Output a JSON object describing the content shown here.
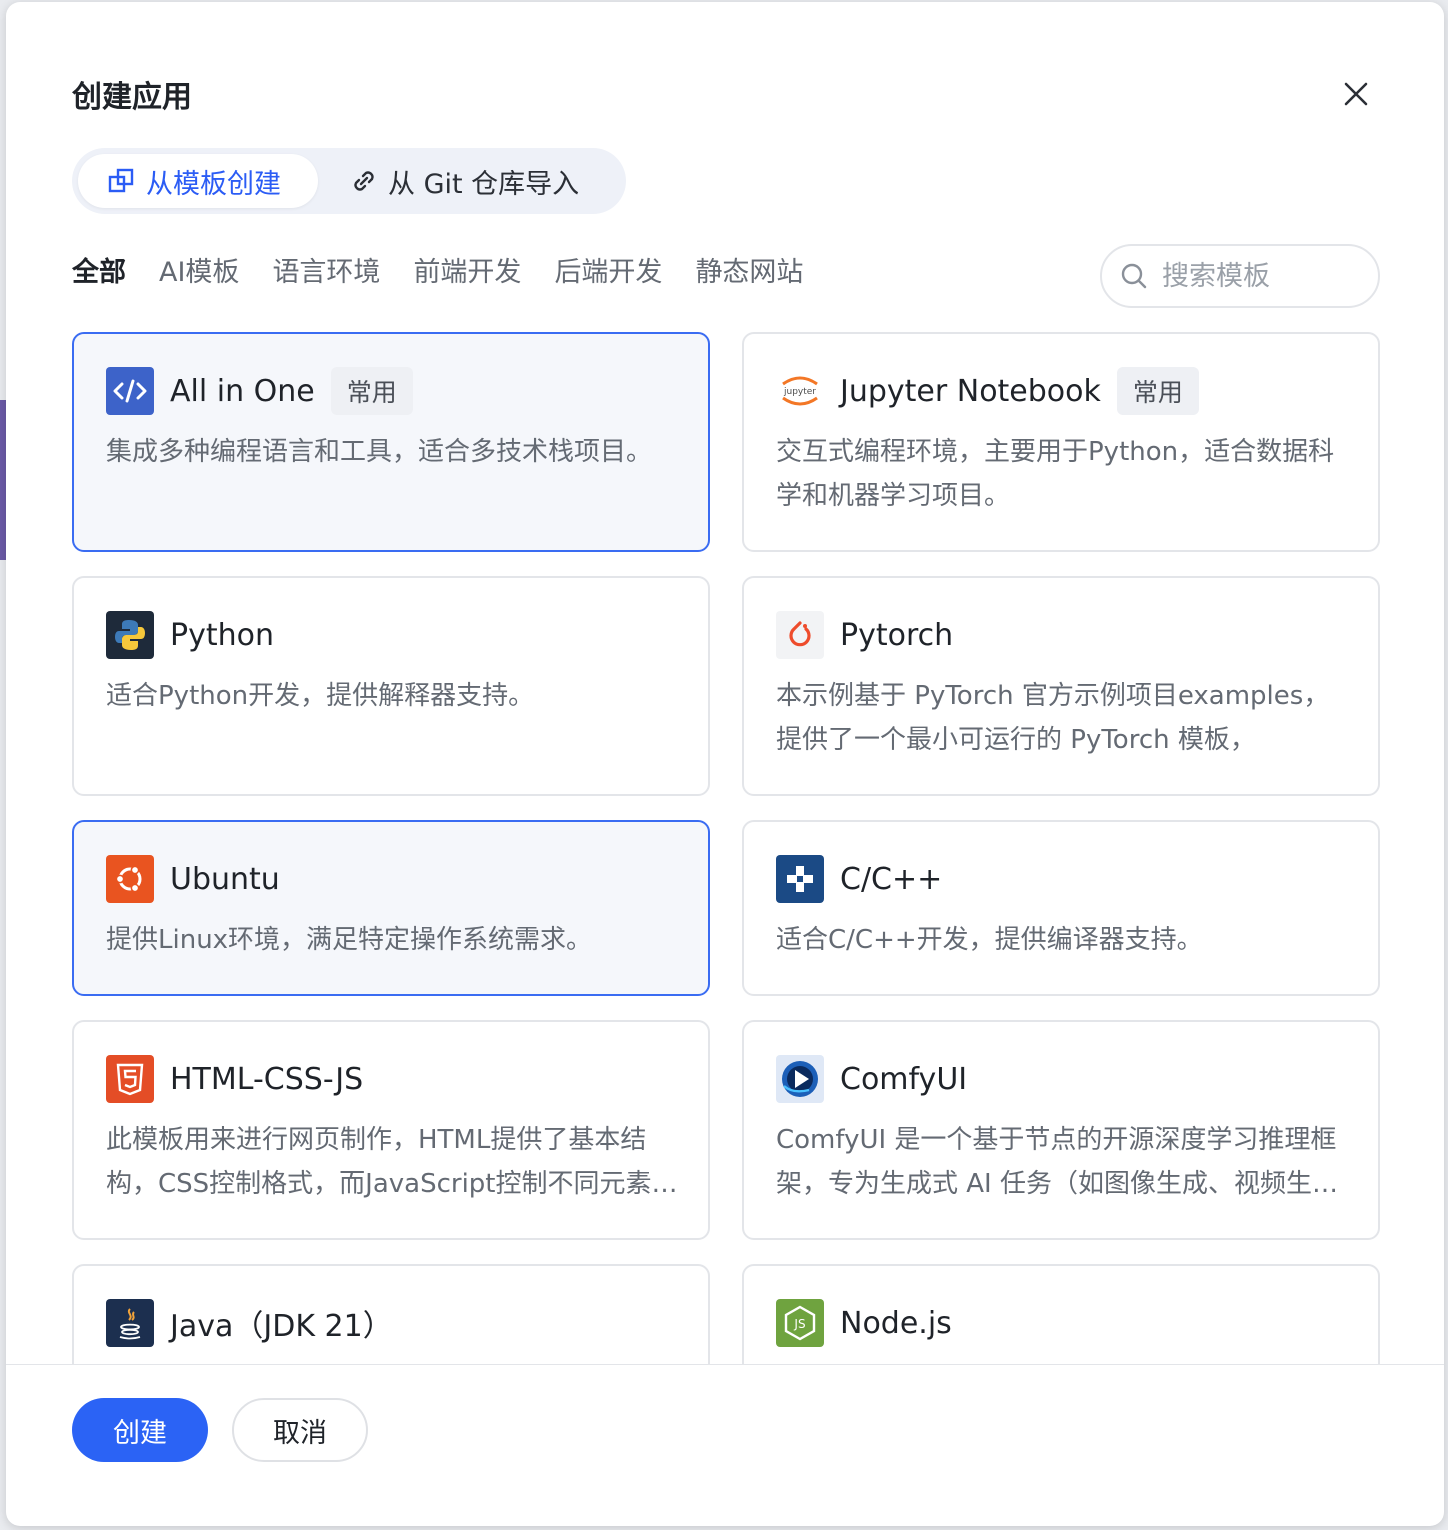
{
  "dialog": {
    "title": "创建应用",
    "close_icon": "close-icon"
  },
  "mode_tabs": [
    {
      "label": "从模板创建",
      "icon": "template-icon",
      "active": true
    },
    {
      "label": "从 Git 仓库导入",
      "icon": "link-icon",
      "active": false
    }
  ],
  "category_tabs": [
    {
      "label": "全部",
      "active": true
    },
    {
      "label": "AI模板",
      "active": false
    },
    {
      "label": "语言环境",
      "active": false
    },
    {
      "label": "前端开发",
      "active": false
    },
    {
      "label": "后端开发",
      "active": false
    },
    {
      "label": "静态网站",
      "active": false
    }
  ],
  "search": {
    "placeholder": "搜索模板",
    "value": ""
  },
  "templates": [
    {
      "name": "All in One",
      "badge": "常用",
      "desc": "集成多种编程语言和工具，适合多技术栈项目。",
      "icon": "code-icon",
      "selected": true
    },
    {
      "name": "Jupyter Notebook",
      "badge": "常用",
      "desc": "交互式编程环境，主要用于Python，适合数据科学和机器学习项目。",
      "icon": "jupyter-icon",
      "selected": false
    },
    {
      "name": "Python",
      "badge": "",
      "desc": "适合Python开发，提供解释器支持。",
      "icon": "python-icon",
      "selected": false
    },
    {
      "name": "Pytorch",
      "badge": "",
      "desc": "本示例基于 PyTorch 官方示例项目examples，提供了一个最小可运行的 PyTorch 模板，",
      "icon": "pytorch-icon",
      "selected": false
    },
    {
      "name": "Ubuntu",
      "badge": "",
      "desc": "提供Linux环境，满足特定操作系统需求。",
      "icon": "ubuntu-icon",
      "selected": true
    },
    {
      "name": "C/C++",
      "badge": "",
      "desc": "适合C/C++开发，提供编译器支持。",
      "icon": "cpp-icon",
      "selected": false
    },
    {
      "name": "HTML-CSS-JS",
      "badge": "",
      "desc": "此模板用来进行网页制作，HTML提供了基本结构，CSS控制格式，而JavaScript控制不同元素的行为。",
      "icon": "html5-icon",
      "selected": false
    },
    {
      "name": "ComfyUI",
      "badge": "",
      "desc": "ComfyUI 是一个基于节点的开源深度学习推理框架，专为生成式 AI 任务（如图像生成、视频生成等）设计。",
      "icon": "comfyui-icon",
      "selected": false
    },
    {
      "name": "Java（JDK 21）",
      "badge": "",
      "desc": "",
      "icon": "java-icon",
      "selected": false
    },
    {
      "name": "Node.js",
      "badge": "",
      "desc": "",
      "icon": "nodejs-icon",
      "selected": false
    }
  ],
  "footer": {
    "create_label": "创建",
    "cancel_label": "取消"
  },
  "colors": {
    "accent": "#2b63f5",
    "selected_border": "#3a6cf2",
    "text_primary": "#1f2329",
    "text_secondary": "#646a73"
  }
}
